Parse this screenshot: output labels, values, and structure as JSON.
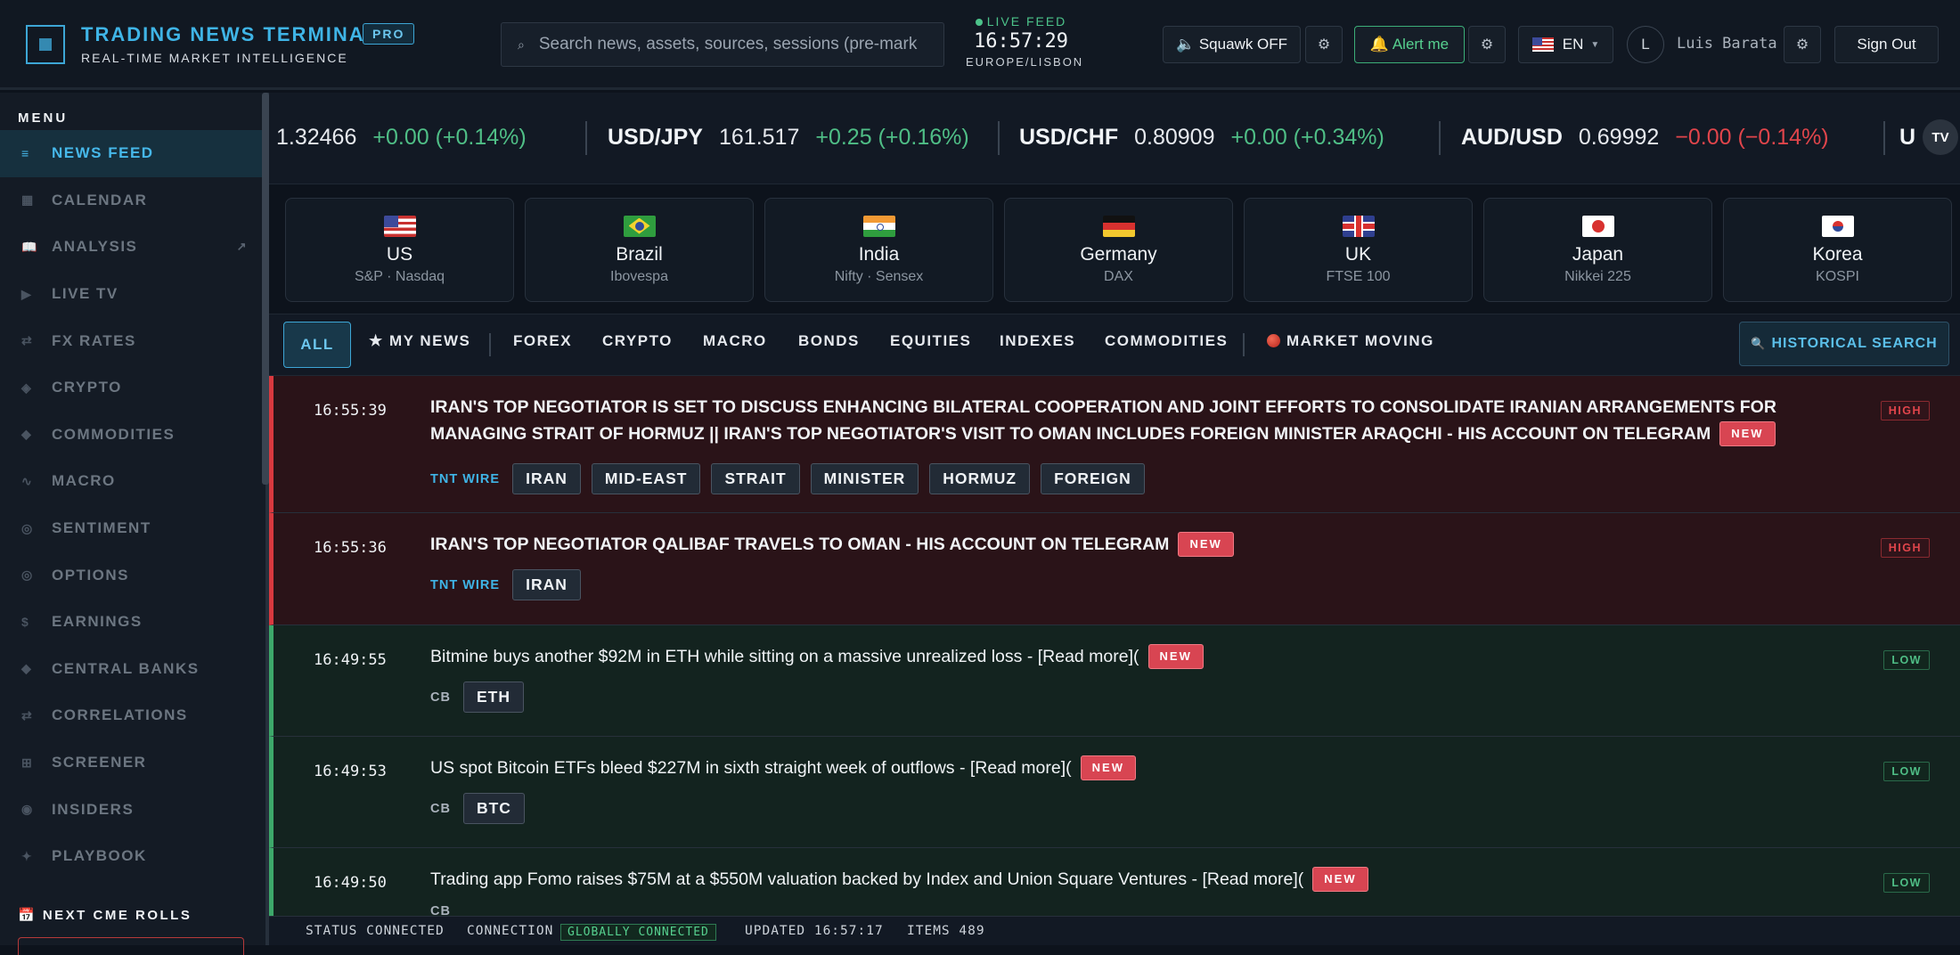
{
  "brand": {
    "title": "TRADING NEWS TERMINAL",
    "subtitle": "REAL-TIME MARKET INTELLIGENCE",
    "badge": "PRO"
  },
  "search": {
    "placeholder": "Search news, assets, sources, sessions (pre-mark"
  },
  "live": {
    "label": "LIVE FEED",
    "clock": "16:57:29",
    "timezone": "EUROPE/LISBON"
  },
  "header_buttons": {
    "squawk": "🔈 Squawk OFF",
    "alert": "🔔 Alert me",
    "lang": "EN",
    "avatar": "L",
    "user": "Luis Barata",
    "signout": "Sign Out",
    "gear": "⚙"
  },
  "sidebar": {
    "menu_title": "MENU",
    "items": [
      {
        "label": "NEWS FEED",
        "icon": "≡"
      },
      {
        "label": "CALENDAR",
        "icon": "▦"
      },
      {
        "label": "ANALYSIS",
        "icon": "📖",
        "ext": "↗"
      },
      {
        "label": "LIVE TV",
        "icon": "▶"
      },
      {
        "label": "FX RATES",
        "icon": "⇄"
      },
      {
        "label": "CRYPTO",
        "icon": "◈"
      },
      {
        "label": "COMMODITIES",
        "icon": "◆"
      },
      {
        "label": "MACRO",
        "icon": "∿"
      },
      {
        "label": "SENTIMENT",
        "icon": "◎"
      },
      {
        "label": "OPTIONS",
        "icon": "◎"
      },
      {
        "label": "EARNINGS",
        "icon": "$"
      },
      {
        "label": "CENTRAL BANKS",
        "icon": "◆"
      },
      {
        "label": "CORRELATIONS",
        "icon": "⇄"
      },
      {
        "label": "SCREENER",
        "icon": "⊞"
      },
      {
        "label": "INSIDERS",
        "icon": "◉"
      },
      {
        "label": "PLAYBOOK",
        "icon": "✦"
      }
    ],
    "cme_title": "📅 NEXT CME ROLLS"
  },
  "ticker": [
    {
      "pair": "",
      "price": "1.32466",
      "change": "+0.00 (+0.14%)",
      "dir": "up"
    },
    {
      "pair": "USD/JPY",
      "price": "161.517",
      "change": "+0.25 (+0.16%)",
      "dir": "up"
    },
    {
      "pair": "USD/CHF",
      "price": "0.80909",
      "change": "+0.00 (+0.34%)",
      "dir": "up"
    },
    {
      "pair": "AUD/USD",
      "price": "0.69992",
      "change": "−0.00 (−0.14%)",
      "dir": "down"
    },
    {
      "pair": "U",
      "price": "",
      "change": "",
      "dir": "up"
    }
  ],
  "tv_icon": "TV",
  "markets": [
    {
      "country": "US",
      "index": "S&P · Nasdaq",
      "flag": "us"
    },
    {
      "country": "Brazil",
      "index": "Ibovespa",
      "flag": "br"
    },
    {
      "country": "India",
      "index": "Nifty · Sensex",
      "flag": "in"
    },
    {
      "country": "Germany",
      "index": "DAX",
      "flag": "de"
    },
    {
      "country": "UK",
      "index": "FTSE 100",
      "flag": "uk"
    },
    {
      "country": "Japan",
      "index": "Nikkei 225",
      "flag": "jp"
    },
    {
      "country": "Korea",
      "index": "KOSPI",
      "flag": "kr"
    }
  ],
  "filters": {
    "all": "ALL",
    "my_news": "★ MY NEWS",
    "forex": "FOREX",
    "crypto": "CRYPTO",
    "macro": "MACRO",
    "bonds": "BONDS",
    "equities": "EQUITIES",
    "indexes": "INDEXES",
    "commodities": "COMMODITIES",
    "market_moving": "MARKET MOVING",
    "historical": "HISTORICAL SEARCH"
  },
  "news": [
    {
      "time": "16:55:39",
      "priority": "HIGH",
      "level": "high",
      "headline": "IRAN'S TOP NEGOTIATOR IS SET TO DISCUSS ENHANCING BILATERAL COOPERATION AND JOINT EFFORTS TO CONSOLIDATE IRANIAN ARRANGEMENTS FOR MANAGING STRAIT OF HORMUZ || IRAN'S TOP NEGOTIATOR'S VISIT TO OMAN INCLUDES FOREIGN MINISTER ARAQCHI - HIS ACCOUNT ON TELEGRAM",
      "badge": "NEW",
      "source": "TNT WIRE",
      "source_type": "wire",
      "tags": [
        "IRAN",
        "MID-EAST",
        "STRAIT",
        "MINISTER",
        "HORMUZ",
        "FOREIGN"
      ]
    },
    {
      "time": "16:55:36",
      "priority": "HIGH",
      "level": "high",
      "headline": "IRAN'S TOP NEGOTIATOR QALIBAF TRAVELS TO OMAN - HIS ACCOUNT ON TELEGRAM",
      "badge": "NEW",
      "source": "TNT WIRE",
      "source_type": "wire",
      "tags": [
        "IRAN"
      ]
    },
    {
      "time": "16:49:55",
      "priority": "LOW",
      "level": "low",
      "headline": "Bitmine buys another $92M in ETH while sitting on a massive unrealized loss - [Read more](",
      "badge": "NEW",
      "source": "CB",
      "source_type": "cb",
      "tags": [
        "ETH"
      ]
    },
    {
      "time": "16:49:53",
      "priority": "LOW",
      "level": "low",
      "headline": "US spot Bitcoin ETFs bleed $227M in sixth straight week of outflows - [Read more](",
      "badge": "NEW",
      "source": "CB",
      "source_type": "cb",
      "tags": [
        "BTC"
      ]
    },
    {
      "time": "16:49:50",
      "priority": "LOW",
      "level": "low",
      "headline": "Trading app Fomo raises $75M at a $550M valuation backed by Index and Union Square Ventures - [Read more](",
      "badge": "NEW",
      "source": "CB",
      "source_type": "cb",
      "tags": []
    }
  ],
  "status": {
    "status_label": "STATUS CONNECTED",
    "connection_label": "CONNECTION",
    "connection_badge": "GLOBALLY CONNECTED",
    "updated": "UPDATED 16:57:17",
    "items": "ITEMS 489"
  },
  "colors": {
    "accent": "#3fb4e6",
    "high": "#d8393f",
    "low": "#3da86a",
    "new_badge": "#d84552"
  }
}
